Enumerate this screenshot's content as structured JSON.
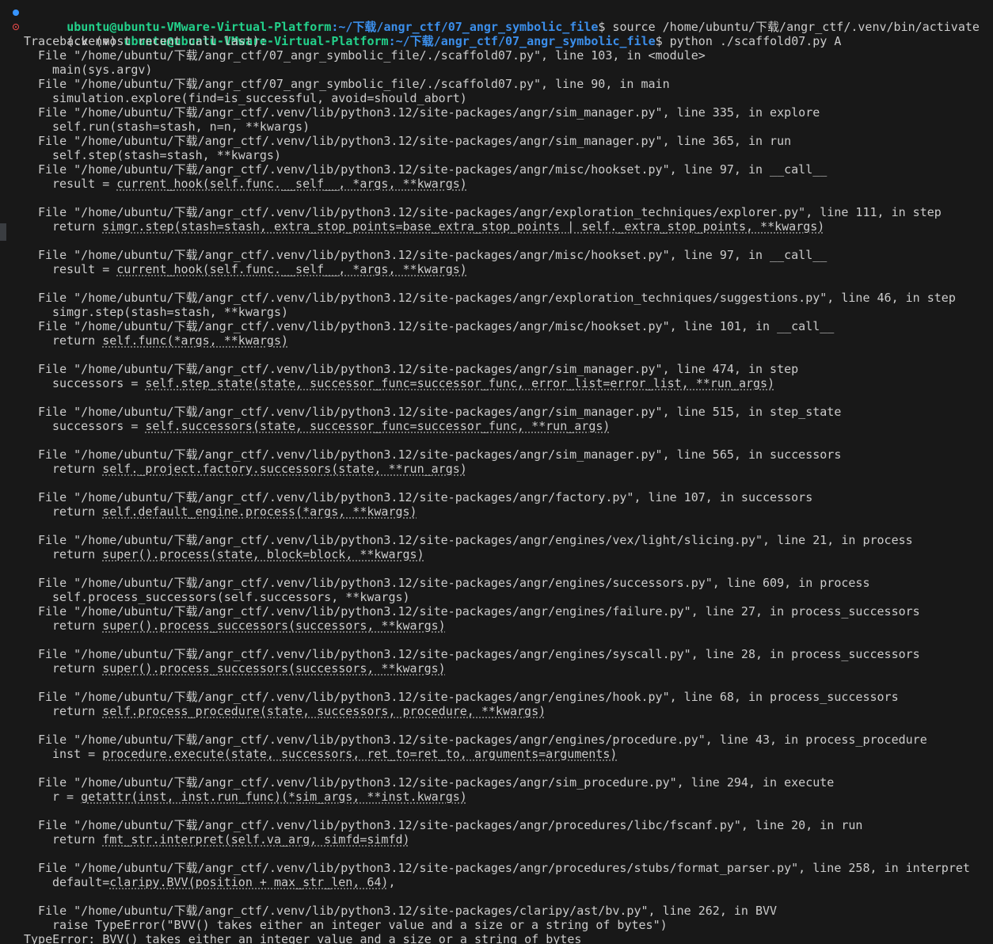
{
  "prompt1": {
    "user": "ubuntu@ubuntu-VMware-Virtual-Platform",
    "path": ":~/下载/angr_ctf/07_angr_symbolic_file",
    "symbol": "$",
    "command": " source /home/ubuntu/下载/angr_ctf/.venv/bin/activate"
  },
  "prompt2": {
    "venv": "(.venv) ",
    "user": "ubuntu@ubuntu-VMware-Virtual-Platform",
    "path": ":~/下载/angr_ctf/07_angr_symbolic_file",
    "symbol": "$",
    "command": " python ./scaffold07.py A"
  },
  "traceback_header": "Traceback (most recent call last):",
  "frames": [
    {
      "file": "File \"/home/ubuntu/下载/angr_ctf/07_angr_symbolic_file/./scaffold07.py\", line 103, in <module>",
      "pre": "main(sys.argv)",
      "hl": "",
      "post": "",
      "blank_after": false
    },
    {
      "file": "File \"/home/ubuntu/下载/angr_ctf/07_angr_symbolic_file/./scaffold07.py\", line 90, in main",
      "pre": "simulation.explore(find=is_successful, avoid=should_abort)",
      "hl": "",
      "post": "",
      "blank_after": false
    },
    {
      "file": "File \"/home/ubuntu/下载/angr_ctf/.venv/lib/python3.12/site-packages/angr/sim_manager.py\", line 335, in explore",
      "pre": "self.run(stash=stash, n=n, **kwargs)",
      "hl": "",
      "post": "",
      "blank_after": false
    },
    {
      "file": "File \"/home/ubuntu/下载/angr_ctf/.venv/lib/python3.12/site-packages/angr/sim_manager.py\", line 365, in run",
      "pre": "self.step(stash=stash, **kwargs)",
      "hl": "",
      "post": "",
      "blank_after": false
    },
    {
      "file": "File \"/home/ubuntu/下载/angr_ctf/.venv/lib/python3.12/site-packages/angr/misc/hookset.py\", line 97, in __call__",
      "pre": "result = ",
      "hl": "current_hook(self.func.__self__, *args, **kwargs)",
      "post": "",
      "blank_after": true
    },
    {
      "file": "File \"/home/ubuntu/下载/angr_ctf/.venv/lib/python3.12/site-packages/angr/exploration_techniques/explorer.py\", line 111, in step",
      "pre": "return ",
      "hl": "simgr.step(stash=stash, extra_stop_points=base_extra_stop_points | self._extra_stop_points, **kwargs)",
      "post": "",
      "blank_after": true
    },
    {
      "file": "File \"/home/ubuntu/下载/angr_ctf/.venv/lib/python3.12/site-packages/angr/misc/hookset.py\", line 97, in __call__",
      "pre": "result = ",
      "hl": "current_hook(self.func.__self__, *args, **kwargs)",
      "post": "",
      "blank_after": true
    },
    {
      "file": "File \"/home/ubuntu/下载/angr_ctf/.venv/lib/python3.12/site-packages/angr/exploration_techniques/suggestions.py\", line 46, in step",
      "pre": "simgr.step(stash=stash, **kwargs)",
      "hl": "",
      "post": "",
      "blank_after": false
    },
    {
      "file": "File \"/home/ubuntu/下载/angr_ctf/.venv/lib/python3.12/site-packages/angr/misc/hookset.py\", line 101, in __call__",
      "pre": "return ",
      "hl": "self.func(*args, **kwargs)",
      "post": "",
      "blank_after": true
    },
    {
      "file": "File \"/home/ubuntu/下载/angr_ctf/.venv/lib/python3.12/site-packages/angr/sim_manager.py\", line 474, in step",
      "pre": "successors = ",
      "hl": "self.step_state(state, successor_func=successor_func, error_list=error_list, **run_args)",
      "post": "",
      "blank_after": true
    },
    {
      "file": "File \"/home/ubuntu/下载/angr_ctf/.venv/lib/python3.12/site-packages/angr/sim_manager.py\", line 515, in step_state",
      "pre": "successors = ",
      "hl": "self.successors(state, successor_func=successor_func, **run_args)",
      "post": "",
      "blank_after": true
    },
    {
      "file": "File \"/home/ubuntu/下载/angr_ctf/.venv/lib/python3.12/site-packages/angr/sim_manager.py\", line 565, in successors",
      "pre": "return ",
      "hl": "self._project.factory.successors(state, **run_args)",
      "post": "",
      "blank_after": true
    },
    {
      "file": "File \"/home/ubuntu/下载/angr_ctf/.venv/lib/python3.12/site-packages/angr/factory.py\", line 107, in successors",
      "pre": "return ",
      "hl": "self.default_engine.process(*args, **kwargs)",
      "post": "",
      "blank_after": true
    },
    {
      "file": "File \"/home/ubuntu/下载/angr_ctf/.venv/lib/python3.12/site-packages/angr/engines/vex/light/slicing.py\", line 21, in process",
      "pre": "return ",
      "hl": "super().process(state, block=block, **kwargs)",
      "post": "",
      "blank_after": true
    },
    {
      "file": "File \"/home/ubuntu/下载/angr_ctf/.venv/lib/python3.12/site-packages/angr/engines/successors.py\", line 609, in process",
      "pre": "self.process_successors(self.successors, **kwargs)",
      "hl": "",
      "post": "",
      "blank_after": false
    },
    {
      "file": "File \"/home/ubuntu/下载/angr_ctf/.venv/lib/python3.12/site-packages/angr/engines/failure.py\", line 27, in process_successors",
      "pre": "return ",
      "hl": "super().process_successors(successors, **kwargs)",
      "post": "",
      "blank_after": true
    },
    {
      "file": "File \"/home/ubuntu/下载/angr_ctf/.venv/lib/python3.12/site-packages/angr/engines/syscall.py\", line 28, in process_successors",
      "pre": "return ",
      "hl": "super().process_successors(successors, **kwargs)",
      "post": "",
      "blank_after": true
    },
    {
      "file": "File \"/home/ubuntu/下载/angr_ctf/.venv/lib/python3.12/site-packages/angr/engines/hook.py\", line 68, in process_successors",
      "pre": "return ",
      "hl": "self.process_procedure(state, successors, procedure, **kwargs)",
      "post": "",
      "blank_after": true
    },
    {
      "file": "File \"/home/ubuntu/下载/angr_ctf/.venv/lib/python3.12/site-packages/angr/engines/procedure.py\", line 43, in process_procedure",
      "pre": "inst = ",
      "hl": "procedure.execute(state, successors, ret_to=ret_to, arguments=arguments)",
      "post": "",
      "blank_after": true
    },
    {
      "file": "File \"/home/ubuntu/下载/angr_ctf/.venv/lib/python3.12/site-packages/angr/sim_procedure.py\", line 294, in execute",
      "pre": "r = ",
      "hl": "getattr(inst, inst.run_func)(*sim_args, **inst.kwargs)",
      "post": "",
      "blank_after": true
    },
    {
      "file": "File \"/home/ubuntu/下载/angr_ctf/.venv/lib/python3.12/site-packages/angr/procedures/libc/fscanf.py\", line 20, in run",
      "pre": "return ",
      "hl": "fmt_str.interpret(self.va_arg, simfd=simfd)",
      "post": "",
      "blank_after": true
    },
    {
      "file": "File \"/home/ubuntu/下载/angr_ctf/.venv/lib/python3.12/site-packages/angr/procedures/stubs/format_parser.py\", line 258, in interpret",
      "pre": "default=",
      "hl": "claripy.BVV(position + max_str_len, 64)",
      "post": ",",
      "blank_after": true
    },
    {
      "file": "File \"/home/ubuntu/下载/angr_ctf/.venv/lib/python3.12/site-packages/claripy/ast/bv.py\", line 262, in BVV",
      "pre": "raise TypeError(\"BVV() takes either an integer value and a size or a string of bytes\")",
      "hl": "",
      "post": "",
      "blank_after": false
    }
  ],
  "error_line": "TypeError: BVV() takes either an integer value and a size or a string of bytes",
  "colors": {
    "background": "#181818",
    "text": "#cccccc",
    "prompt_user": "#23d18b",
    "prompt_path": "#3b8eea",
    "status_ok": "#3794ff",
    "status_error": "#f14c4c"
  }
}
